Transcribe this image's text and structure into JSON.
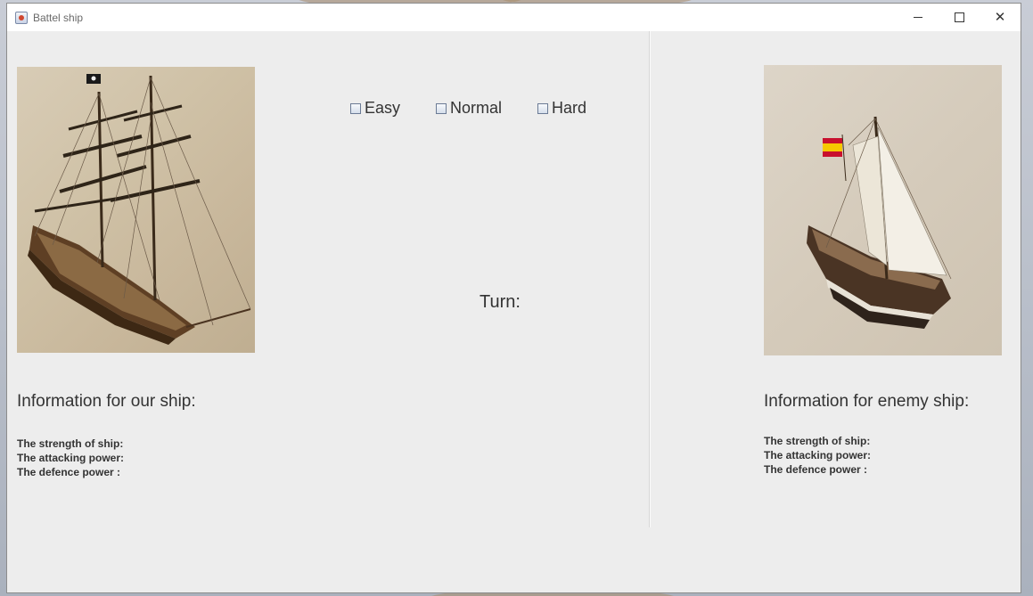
{
  "window": {
    "title": "Battel ship",
    "controls": {
      "minimize": "minimize-icon",
      "maximize": "maximize-icon",
      "close": "close-icon"
    }
  },
  "difficulty": {
    "options": [
      {
        "label": "Easy",
        "checked": false
      },
      {
        "label": "Normal",
        "checked": false
      },
      {
        "label": "Hard",
        "checked": false
      }
    ]
  },
  "turn": {
    "label": "Turn:"
  },
  "our_ship": {
    "title": "Information for our ship:",
    "strength_label": "The strength of ship:",
    "attack_label": "The attacking power:",
    "defence_label": "The defence power :"
  },
  "enemy_ship": {
    "title": "Information for enemy ship:",
    "strength_label": "The strength of ship:",
    "attack_label": "The attacking power:",
    "defence_label": "The defence power :"
  },
  "colors": {
    "window_bg": "#ededed",
    "titlebar_bg": "#ffffff",
    "text": "#333333"
  }
}
